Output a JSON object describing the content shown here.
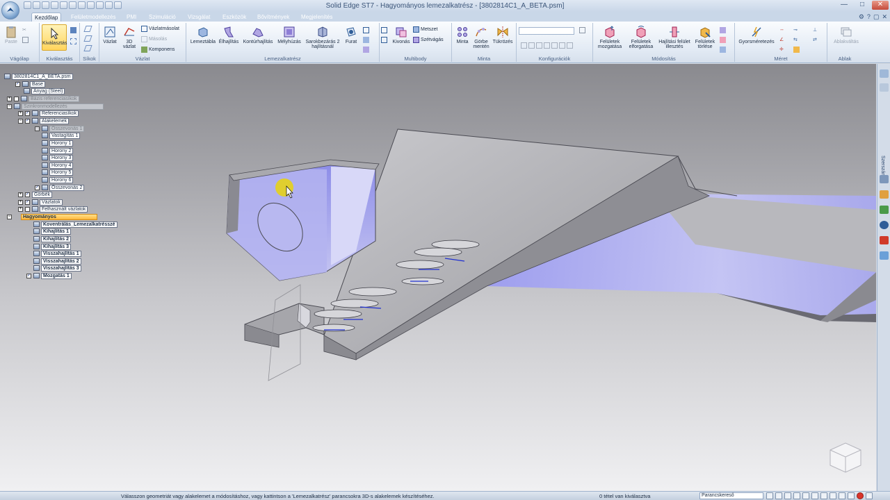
{
  "window": {
    "title": "Solid Edge ST7 - Hagyományos lemezalkatrész - [3802814C1_A_BETA.psm]"
  },
  "tabs": [
    {
      "label": "Kezdőlap",
      "active": true
    },
    {
      "label": "Felületmodellezés",
      "active": false
    },
    {
      "label": "PMI",
      "active": false
    },
    {
      "label": "Szimuláció",
      "active": false
    },
    {
      "label": "Vizsgálat",
      "active": false
    },
    {
      "label": "Eszközök",
      "active": false
    },
    {
      "label": "Bővítmények",
      "active": false
    },
    {
      "label": "Megjelenítés",
      "active": false
    }
  ],
  "ribbon": {
    "groups": {
      "vagolap": "Vágólap",
      "kivalasztas": "Kiválasztás",
      "sikok": "Síkok",
      "vazlat": "Vázlat",
      "lemezalkatresz": "Lemezalkatrész",
      "multibody": "Multibody",
      "minta": "Minta",
      "konfiguraciok": "Konfigurációk",
      "modositas": "Módosítás",
      "meret": "Méret",
      "ablak": "Ablak"
    },
    "buttons": {
      "paste": "Paste",
      "select": "Kiválasztás",
      "sketch": "Vázlat",
      "sketch_3d": "3D vázlat",
      "sketch_copy": "Vázlatmásolat",
      "copy": "Másolás",
      "component": "Komponens",
      "tab": "Lemeztábla",
      "flange": "Élhajlítás",
      "contour_flange": "Kontúrhajlítás",
      "dimple": "Mélyhúzás",
      "corner_close": "Sarokbezárás 2 hajlításnál",
      "hole": "Furat",
      "subtract": "Kivonás",
      "intersect": "Metszet",
      "split": "Szétvágás",
      "pattern": "Minta",
      "curve_pattern": "Görbe mentén",
      "mirror": "Tükrözés",
      "move_faces": "Felületek mozgatása",
      "rotate_faces": "Felületek elforgatása",
      "bend_faces": "Hajlítási felület illesztés",
      "delete_faces": "Felületek törlése",
      "smart_dimension": "Gyorsméretezés",
      "arrange": "Ablakváltás"
    }
  },
  "tree": {
    "items": [
      {
        "label": "3802814C1_A_BETA.psm",
        "expander": "",
        "check": "",
        "style": "normal"
      },
      {
        "label": "Base",
        "expander": "",
        "check": "✓",
        "style": "normal"
      },
      {
        "label": "Anyag (Steel)",
        "expander": "",
        "check": "",
        "style": "normal"
      },
      {
        "label": "Bázis referenciasíkok",
        "expander": "+",
        "check": "",
        "style": "dimmed"
      },
      {
        "label": "Szinkronmodellezés",
        "expander": "−",
        "check": "",
        "style": "dimmed"
      },
      {
        "label": "Referenciasíkok",
        "expander": "+",
        "check": "✓",
        "style": "normal"
      },
      {
        "label": "Alakelemek",
        "expander": "−",
        "check": "✓",
        "style": "normal"
      },
      {
        "label": "Összevonás 1",
        "expander": "",
        "check": "",
        "style": "dimmed"
      },
      {
        "label": "Vastagítás 1",
        "expander": "",
        "check": "",
        "style": "normal"
      },
      {
        "label": "Horony 1",
        "expander": "",
        "check": "",
        "style": "normal"
      },
      {
        "label": "Horony 2",
        "expander": "",
        "check": "",
        "style": "normal"
      },
      {
        "label": "Horony 3",
        "expander": "",
        "check": "",
        "style": "normal"
      },
      {
        "label": "Horony 4",
        "expander": "",
        "check": "",
        "style": "normal"
      },
      {
        "label": "Horony 5",
        "expander": "",
        "check": "",
        "style": "normal"
      },
      {
        "label": "Horony 6",
        "expander": "",
        "check": "",
        "style": "normal"
      },
      {
        "label": "Összevonás 2",
        "expander": "",
        "check": "✓",
        "style": "normal"
      },
      {
        "label": "Görbék",
        "expander": "+",
        "check": "✓",
        "style": "normal"
      },
      {
        "label": "Vázlatok",
        "expander": "+",
        "check": "✓",
        "style": "normal"
      },
      {
        "label": "Felhasznált vázlatok",
        "expander": "+",
        "check": "",
        "style": "normal"
      },
      {
        "label": "Hagyományos",
        "expander": "−",
        "check": "",
        "style": "selected"
      },
      {
        "label": "Koventrálás_Lemezalkatrésszé",
        "expander": "",
        "check": "",
        "style": "bold"
      },
      {
        "label": "Kihajlítás 1",
        "expander": "",
        "check": "",
        "style": "bold"
      },
      {
        "label": "Kihajlítás 2",
        "expander": "",
        "check": "",
        "style": "bold"
      },
      {
        "label": "Kihajlítás 3",
        "expander": "",
        "check": "",
        "style": "bold"
      },
      {
        "label": "Visszahajlítás 1",
        "expander": "",
        "check": "",
        "style": "bold"
      },
      {
        "label": "Visszahajlítás 2",
        "expander": "",
        "check": "",
        "style": "bold"
      },
      {
        "label": "Visszahajlítás 3",
        "expander": "",
        "check": "",
        "style": "bold"
      },
      {
        "label": "Mozgatás 1",
        "expander": "",
        "check": "✓",
        "style": "bold"
      }
    ]
  },
  "rightdock": {
    "label": "Szerszámok"
  },
  "status": {
    "prompt": "Válasszon geometriát vagy alakelemet a módosításhoz, vagy kattintson a 'Lemezalkatrész' parancsokra 3D-s alakelemek készítéséhez.",
    "selection": "0 tétel van kiválasztva",
    "command_finder": "Parancskereső"
  },
  "colors": {
    "accent": "#2f5d98",
    "selection": "#ffc44a",
    "model_face": "#b8b8bd",
    "model_highlight": "#a8a8f0"
  }
}
